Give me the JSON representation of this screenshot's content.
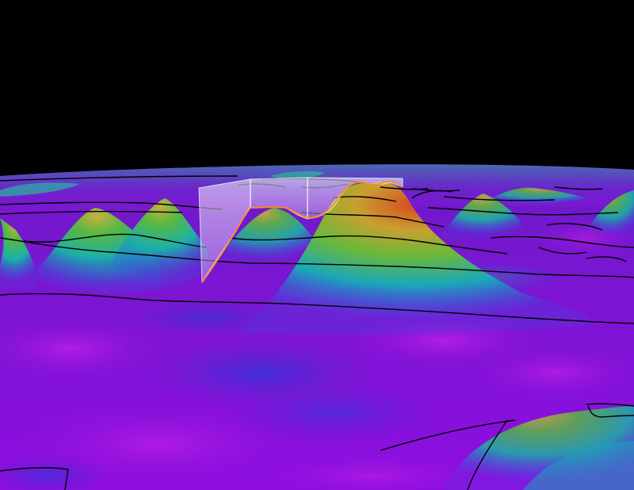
{
  "viewer": {
    "sky_color": "#000000",
    "contour_color": "#000000",
    "section_edge_color": "#e0e8f0",
    "profile_color": "#ff8c1a"
  },
  "surface": {
    "colormap": [
      "#8a10d8",
      "#5a22c8",
      "#2a5ae0",
      "#1aa8b8",
      "#2ab860",
      "#7ab838",
      "#c8a030",
      "#d84a20"
    ]
  },
  "icons": [
    "terrain-surface-icon",
    "cross-section-panel-icon"
  ]
}
